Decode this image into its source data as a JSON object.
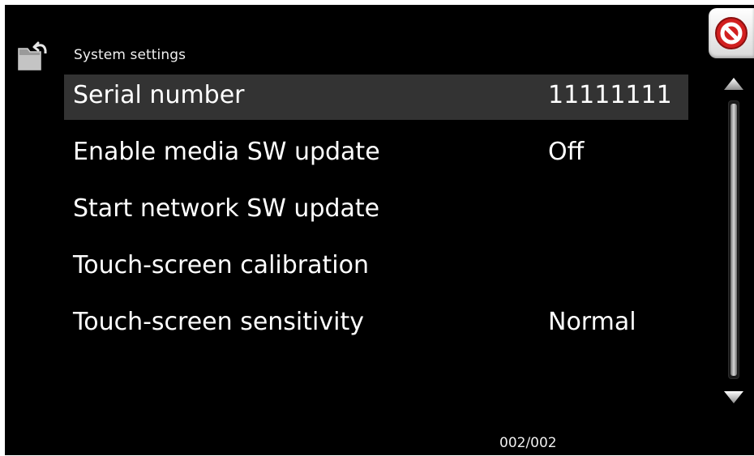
{
  "header": {
    "title": "System settings",
    "back_icon": "folder-back-icon",
    "close_icon": "close-icon"
  },
  "settings": [
    {
      "label": "Serial number",
      "value": "11111111",
      "selected": true
    },
    {
      "label": "Enable media SW update",
      "value": "Off",
      "selected": false
    },
    {
      "label": "Start network SW update",
      "value": "",
      "selected": false
    },
    {
      "label": "Touch-screen calibration",
      "value": "",
      "selected": false
    },
    {
      "label": "Touch-screen sensitivity",
      "value": "Normal",
      "selected": false
    }
  ],
  "scrollbar": {
    "up_icon": "arrow-up-icon",
    "down_icon": "arrow-down-icon",
    "position": 1.0
  },
  "footer": {
    "page_indicator": "002/002"
  },
  "colors": {
    "background": "#000000",
    "selected_row": "#333333",
    "text": "#ffffff",
    "close_accent": "#d21f1f"
  }
}
